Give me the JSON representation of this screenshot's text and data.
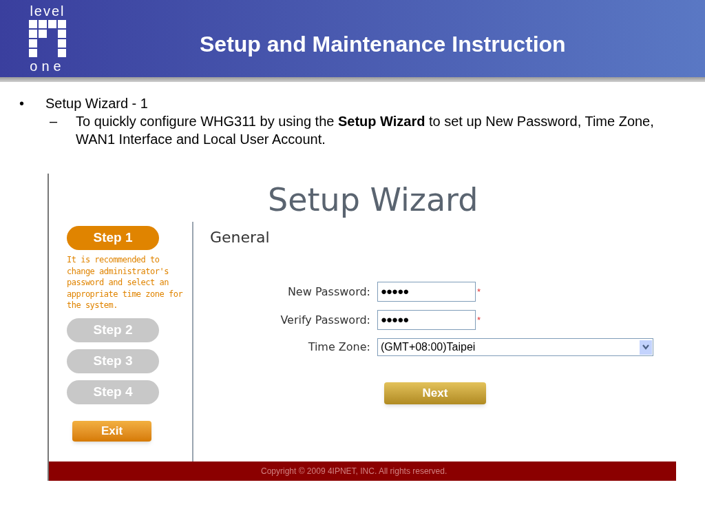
{
  "header": {
    "logo": {
      "top": "level",
      "bottom": "one"
    },
    "title": "Setup and Maintenance Instruction"
  },
  "bullets": [
    {
      "marker": "•",
      "text": "Setup Wizard - 1",
      "children": [
        {
          "marker": "–",
          "text": "To quickly configure WHG311 by using the **Setup Wizard** to set up New Password, Time Zone, WAN1 Interface and Local User Account."
        }
      ]
    }
  ],
  "wizard": {
    "title": "Setup Wizard",
    "steps": [
      {
        "label": "Step 1",
        "selected": true,
        "description": "It is recommended to change administrator's password and select an appropriate time zone for the system."
      },
      {
        "label": "Step 2",
        "selected": false
      },
      {
        "label": "Step 3",
        "selected": false
      },
      {
        "label": "Step 4",
        "selected": false
      }
    ],
    "exit_button": "Exit",
    "section": "General",
    "fields": [
      {
        "kind": "password",
        "label": "New Password:",
        "value": "●●●●●",
        "required": true
      },
      {
        "kind": "password",
        "label": "Verify Password:",
        "value": "●●●●●",
        "required": true
      },
      {
        "kind": "select",
        "label": "Time Zone:",
        "value": "(GMT+08:00)Taipei"
      }
    ],
    "required_mark": "*",
    "next_button": "Next",
    "footer": "Copyright © 2009 4IPNET, INC. All rights reserved."
  }
}
